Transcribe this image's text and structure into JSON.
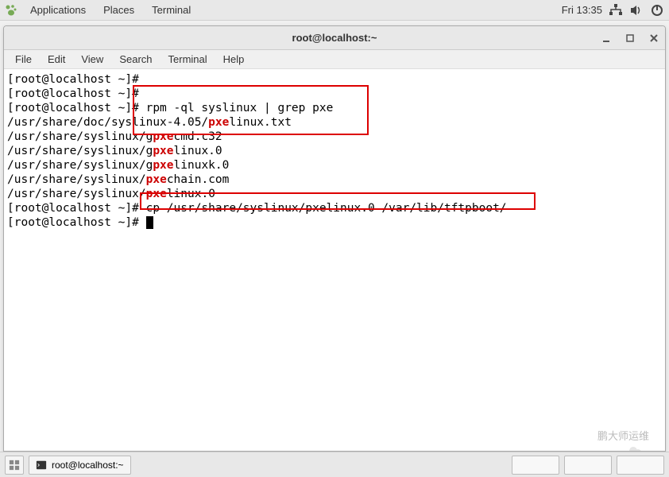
{
  "topbar": {
    "menus": [
      "Applications",
      "Places",
      "Terminal"
    ],
    "clock": "Fri 13:35"
  },
  "window": {
    "title": "root@localhost:~",
    "menubar": [
      "File",
      "Edit",
      "View",
      "Search",
      "Terminal",
      "Help"
    ]
  },
  "terminal": {
    "prompt": "[root@localhost ~]#",
    "lines": [
      {
        "pre": "[root@localhost ~]#",
        "rest": ""
      },
      {
        "pre": "[root@localhost ~]#",
        "rest": ""
      },
      {
        "pre": "[root@localhost ~]#",
        "rest": " rpm -ql syslinux | grep pxe"
      },
      {
        "pre": "/usr/share/doc/syslinux-4.05/",
        "hl": "pxe",
        "post": "linux.txt"
      },
      {
        "pre": "/usr/share/syslinux/g",
        "hl": "pxe",
        "post": "cmd.c32"
      },
      {
        "pre": "/usr/share/syslinux/g",
        "hl": "pxe",
        "post": "linux.0"
      },
      {
        "pre": "/usr/share/syslinux/g",
        "hl": "pxe",
        "post": "linuxk.0"
      },
      {
        "pre": "/usr/share/syslinux/",
        "hl": "pxe",
        "post": "chain.com"
      },
      {
        "pre": "/usr/share/syslinux/",
        "hl": "pxe",
        "post": "linux.0"
      },
      {
        "pre": "[root@localhost ~]#",
        "rest": " cp /usr/share/syslinux/pxelinux.0 /var/lib/tftpboot/"
      },
      {
        "pre": "[root@localhost ~]#",
        "rest": " ",
        "cursor": true
      }
    ]
  },
  "taskbar": {
    "app_label": "root@localhost:~"
  },
  "watermark": "鹏大师运维"
}
